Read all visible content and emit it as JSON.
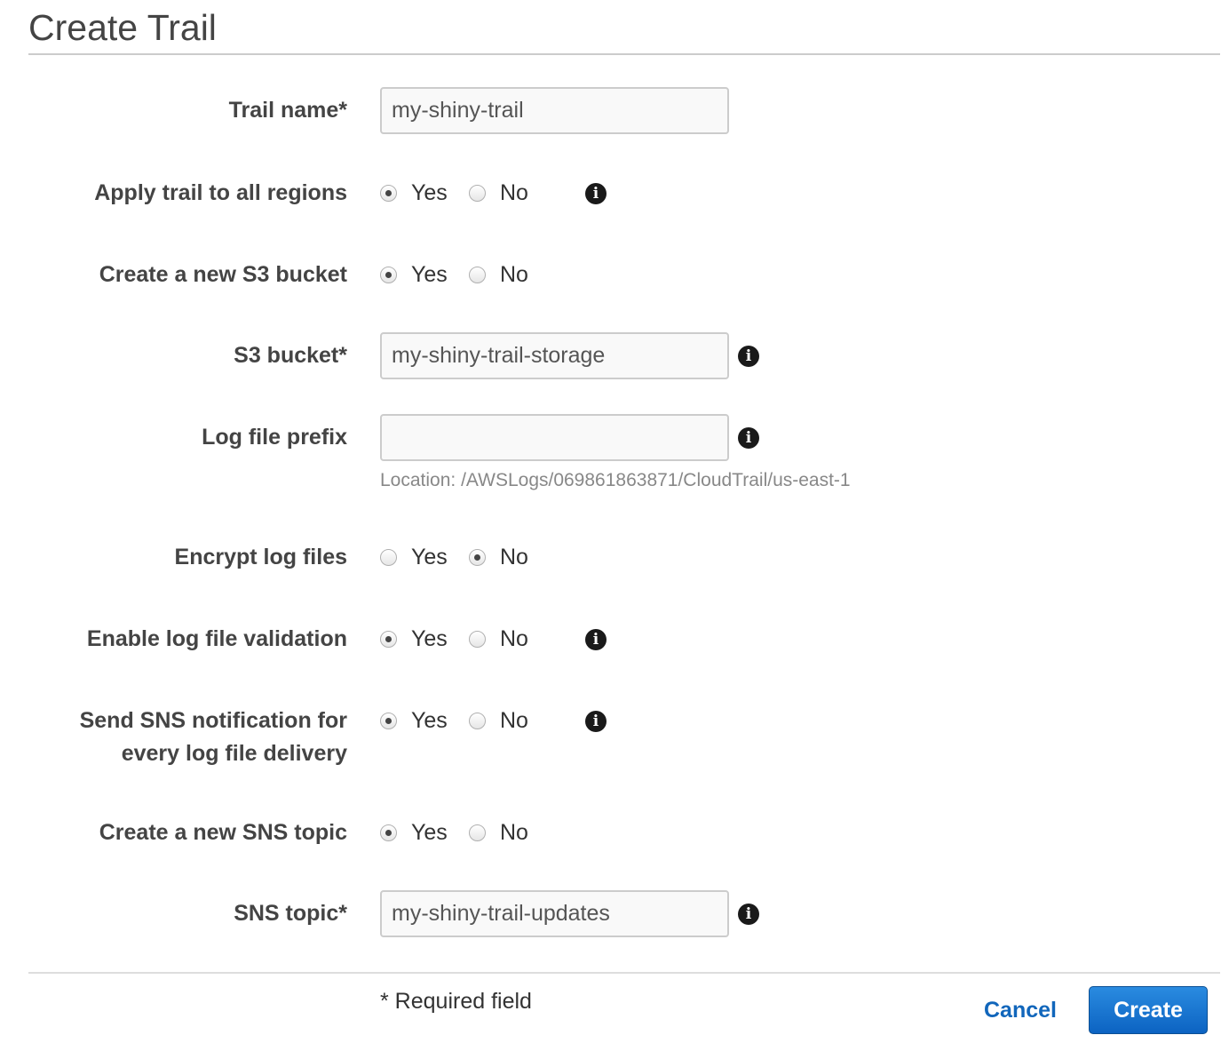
{
  "page": {
    "title": "Create Trail"
  },
  "fields": {
    "trail_name": {
      "label": "Trail name*",
      "value": "my-shiny-trail"
    },
    "apply_all_regions": {
      "label": "Apply trail to all regions",
      "options": [
        "Yes",
        "No"
      ],
      "selected": "Yes",
      "info_icon": "info-icon"
    },
    "create_s3_bucket": {
      "label": "Create a new S3 bucket",
      "options": [
        "Yes",
        "No"
      ],
      "selected": "Yes"
    },
    "s3_bucket": {
      "label": "S3 bucket*",
      "value": "my-shiny-trail-storage",
      "info_icon": "info-icon"
    },
    "log_file_prefix": {
      "label": "Log file prefix",
      "value": "",
      "help": "Location: /AWSLogs/069861863871/CloudTrail/us-east-1",
      "info_icon": "info-icon"
    },
    "encrypt_log_files": {
      "label": "Encrypt log files",
      "options": [
        "Yes",
        "No"
      ],
      "selected": "No"
    },
    "log_file_validation": {
      "label": "Enable log file validation",
      "options": [
        "Yes",
        "No"
      ],
      "selected": "Yes",
      "info_icon": "info-icon"
    },
    "sns_notification": {
      "label_line1": "Send SNS notification for",
      "label_line2": "every log file delivery",
      "options": [
        "Yes",
        "No"
      ],
      "selected": "Yes",
      "info_icon": "info-icon"
    },
    "create_sns_topic": {
      "label": "Create a new SNS topic",
      "options": [
        "Yes",
        "No"
      ],
      "selected": "Yes"
    },
    "sns_topic": {
      "label": "SNS topic*",
      "value": "my-shiny-trail-updates",
      "info_icon": "info-icon"
    }
  },
  "footer": {
    "required_note": "* Required field",
    "cancel_label": "Cancel",
    "create_label": "Create"
  },
  "colors": {
    "primary_button": "#0c63c2",
    "link": "#1166bb",
    "help_text": "#888888"
  }
}
